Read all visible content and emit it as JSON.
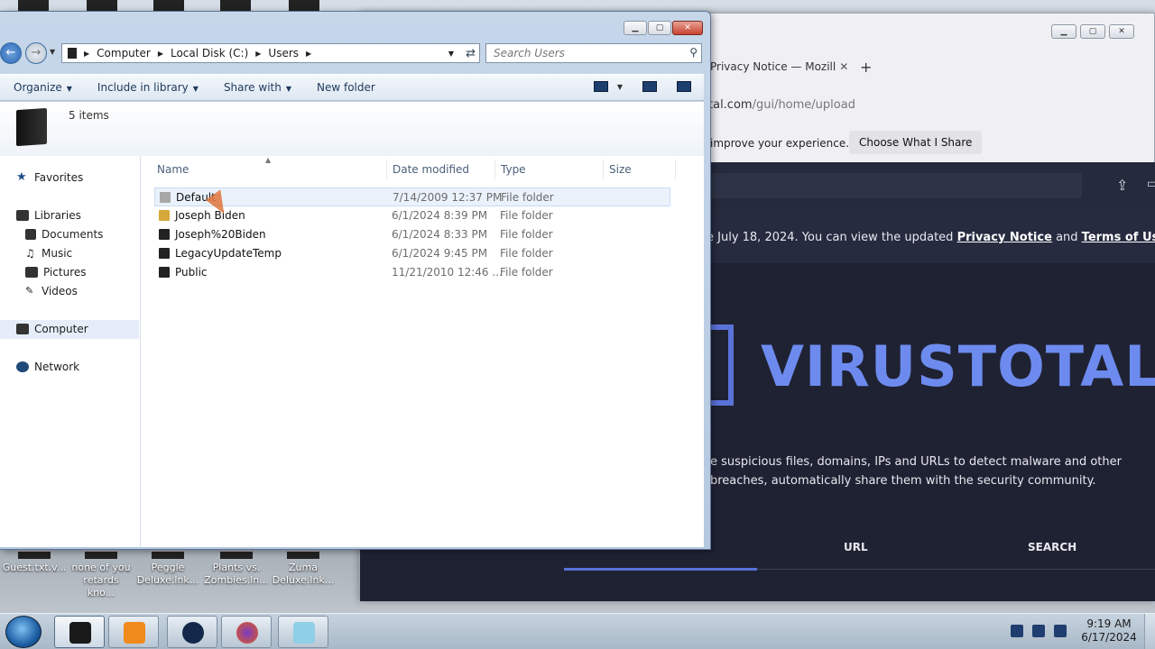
{
  "desktop": {
    "icons": [
      {
        "label": "Guest.txt.v..."
      },
      {
        "label": "none of you retards kno..."
      },
      {
        "label": "Peggle Deluxe.lnk..."
      },
      {
        "label": "Plants vs. Zombies.ln..."
      },
      {
        "label": "Zuma Deluxe.lnk..."
      }
    ]
  },
  "firefox": {
    "tab_title": "Privacy Notice — Mozill",
    "tab_close": "✕",
    "new_tab": "+",
    "url_host": "tal.com",
    "url_path": "/gui/home/upload",
    "notice_text": "improve your experience.",
    "choose_button": "Choose What I Share",
    "policy_text": "e July 18, 2024. You can view the updated",
    "privacy_link": "Privacy Notice",
    "and_text": "and",
    "terms_link": "Terms of Use",
    "logo_text": "VIRUSTOTAL",
    "description": "e suspicious files, domains, IPs and URLs to detect malware and other breaches, automatically share them with the security community.",
    "tab_url": "URL",
    "tab_search": "SEARCH"
  },
  "explorer": {
    "breadcrumb": [
      "Computer",
      "Local Disk (C:)",
      "Users"
    ],
    "search_placeholder": "Search Users",
    "commands": {
      "organize": "Organize",
      "include": "Include in library",
      "share": "Share with",
      "new_folder": "New folder"
    },
    "item_count": "5 items",
    "columns": {
      "name": "Name",
      "date": "Date modified",
      "type": "Type",
      "size": "Size"
    },
    "sidebar": {
      "favorites": "Favorites",
      "libraries": "Libraries",
      "documents": "Documents",
      "music": "Music",
      "pictures": "Pictures",
      "videos": "Videos",
      "computer": "Computer",
      "network": "Network"
    },
    "files": [
      {
        "name": "Default",
        "date": "7/14/2009 12:37 PM",
        "type": "File folder"
      },
      {
        "name": "Joseph Biden",
        "date": "6/1/2024 8:39 PM",
        "type": "File folder"
      },
      {
        "name": "Joseph%20Biden",
        "date": "6/1/2024 8:33 PM",
        "type": "File folder"
      },
      {
        "name": "LegacyUpdateTemp",
        "date": "6/1/2024 9:45 PM",
        "type": "File folder"
      },
      {
        "name": "Public",
        "date": "11/21/2010 12:46 ...",
        "type": "File folder"
      }
    ]
  },
  "taskbar": {
    "time": "9:19 AM",
    "date": "6/17/2024"
  }
}
